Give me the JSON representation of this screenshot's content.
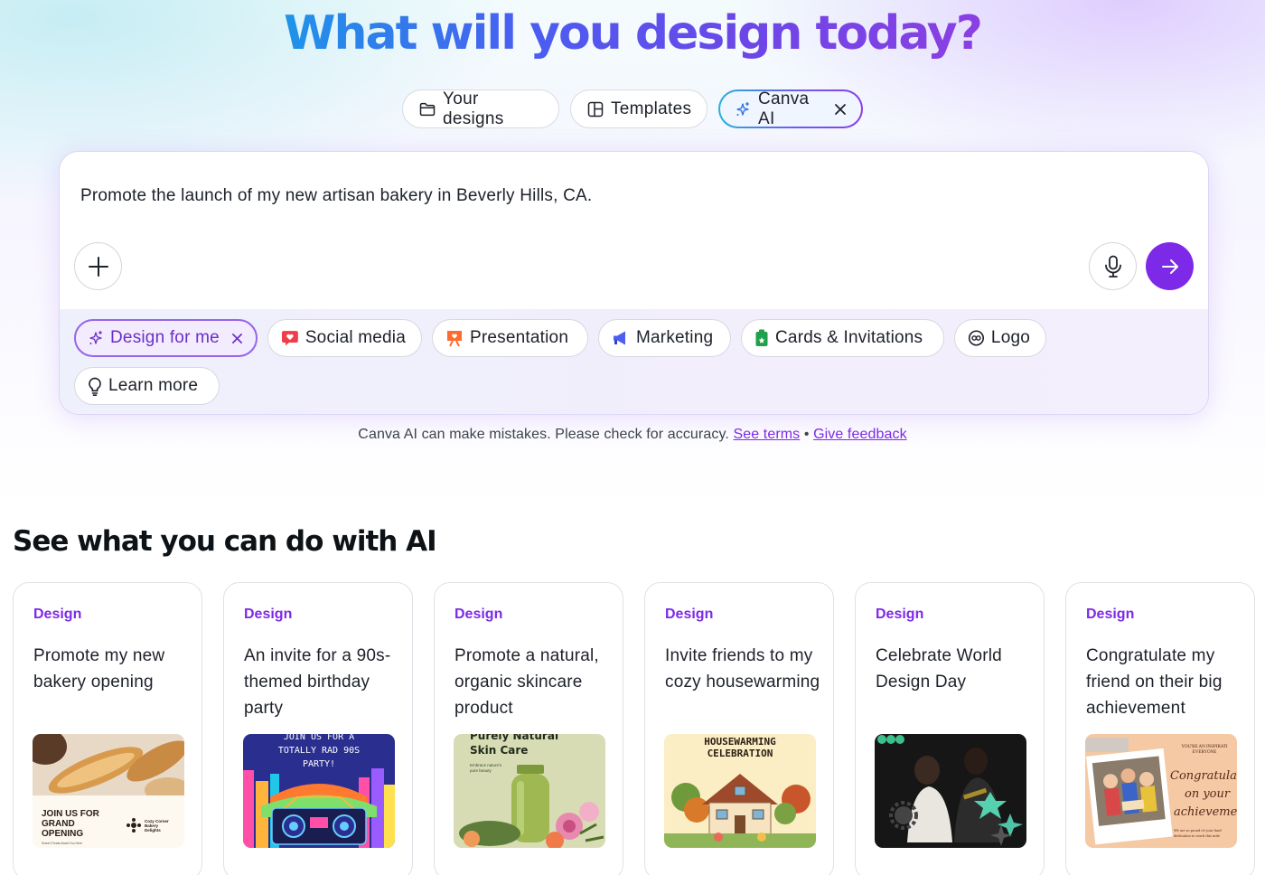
{
  "hero": {
    "headline": "What will you design today?"
  },
  "tabs": [
    {
      "label": "Your designs",
      "icon": "folder-icon"
    },
    {
      "label": "Templates",
      "icon": "template-icon"
    },
    {
      "label": "Canva AI",
      "icon": "sparkle-icon",
      "active": true
    }
  ],
  "prompt": {
    "text": "Promote the launch of my new artisan bakery in Beverly Hills, CA."
  },
  "chips": [
    {
      "label": "Design for me",
      "icon": "sparkle-icon",
      "selected": true
    },
    {
      "label": "Social media",
      "icon": "heart-bubble-icon"
    },
    {
      "label": "Presentation",
      "icon": "presentation-icon"
    },
    {
      "label": "Marketing",
      "icon": "megaphone-icon"
    },
    {
      "label": "Cards & Invitations",
      "icon": "card-icon"
    },
    {
      "label": "Logo",
      "icon": "logo-icon"
    },
    {
      "label": "Learn more",
      "icon": "lightbulb-icon"
    }
  ],
  "disclaimer": {
    "text": "Canva AI can make mistakes. Please check for accuracy.",
    "see_terms": "See terms",
    "separator": "•",
    "give_feedback": "Give feedback"
  },
  "section": {
    "title": "See what you can do with AI"
  },
  "cards": [
    {
      "tag": "Design",
      "title": "Promote my new bakery opening",
      "thumb_text": [
        "JOIN US FOR",
        "GRAND",
        "OPENING"
      ],
      "thumb_sub": "Sweet Treats Await You Here",
      "thumb_brand": [
        "Cozy Corner",
        "Bakery",
        "Delights"
      ]
    },
    {
      "tag": "Design",
      "title": "An invite for a 90s-themed birthday party",
      "thumb_text": [
        "JOIN US FOR A",
        "TOTALLY RAD 90S",
        "PARTY!"
      ]
    },
    {
      "tag": "Design",
      "title": "Promote a natural, organic skincare product",
      "thumb_text": [
        "Purely Natural",
        "Skin Care"
      ],
      "thumb_sub": [
        "Embrace nature's",
        "pure beauty"
      ]
    },
    {
      "tag": "Design",
      "title": "Invite friends to my cozy housewarming",
      "thumb_text": [
        "HOUSEWARMING",
        "CELEBRATION"
      ]
    },
    {
      "tag": "Design",
      "title": "Celebrate World Design Day"
    },
    {
      "tag": "Design",
      "title": "Congratulate my friend on their big achievement",
      "thumb_text": [
        "YOU'RE AN INSPIRATI",
        "EVERYONE"
      ],
      "thumb_script": [
        "Congratulat",
        "on your",
        "achievemen"
      ],
      "thumb_sub": [
        "We are so proud of your hard",
        "dedication to reach this mile"
      ]
    }
  ],
  "colors": {
    "accent": "#7d2ae8",
    "headline_gradient": [
      "#1f93e8",
      "#6b47e8",
      "#8b3fe3"
    ]
  }
}
